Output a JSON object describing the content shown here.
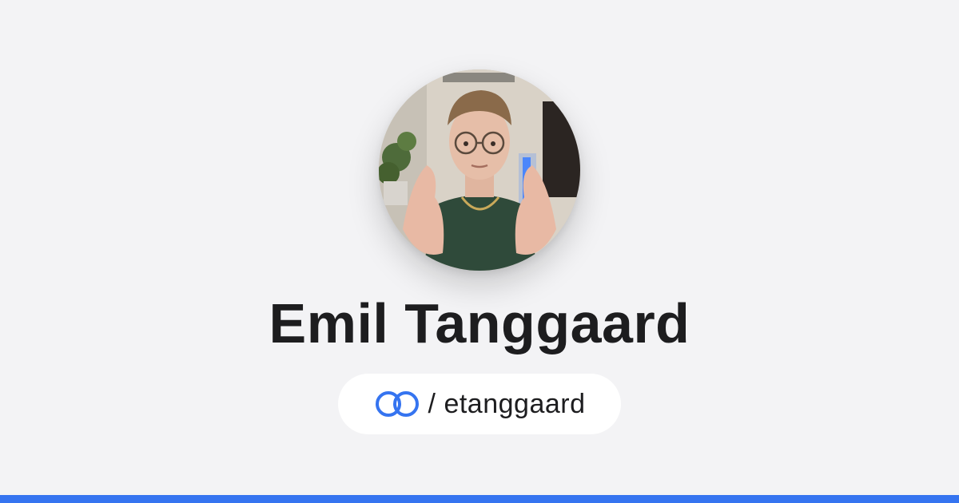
{
  "profile": {
    "name": "Emil Tanggaard",
    "separator": "/",
    "handle": "etanggaard",
    "logo_icon": "linked-rings-icon"
  },
  "colors": {
    "background": "#f3f3f5",
    "accent": "#3574f0",
    "text": "#1d1d1f",
    "pill": "#ffffff"
  }
}
